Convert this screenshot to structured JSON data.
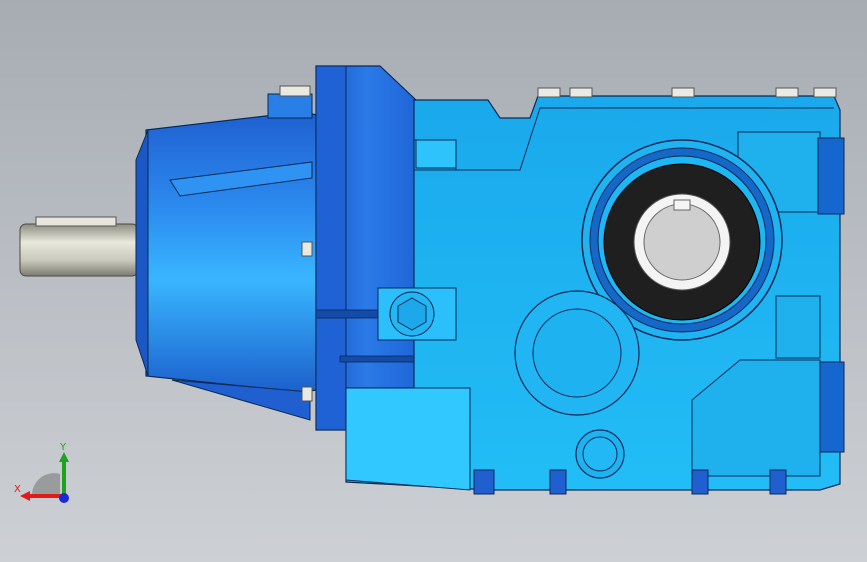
{
  "viewport": {
    "background_top": "#a7acb3",
    "background_bottom": "#cdd0d4"
  },
  "model": {
    "body_color": "#1eb4f0",
    "body_dark": "#1478c8",
    "motor_blue": "#2a7fe6",
    "shaft_color": "#d8d8cc",
    "outline_color": "#0a2a55",
    "bore_ring": "#1f1f1f"
  },
  "triad": {
    "x_label": "X",
    "y_label": "Y",
    "x_color": "#e11a1a",
    "y_color": "#1ea31e",
    "z_color": "#1a2ad8"
  }
}
